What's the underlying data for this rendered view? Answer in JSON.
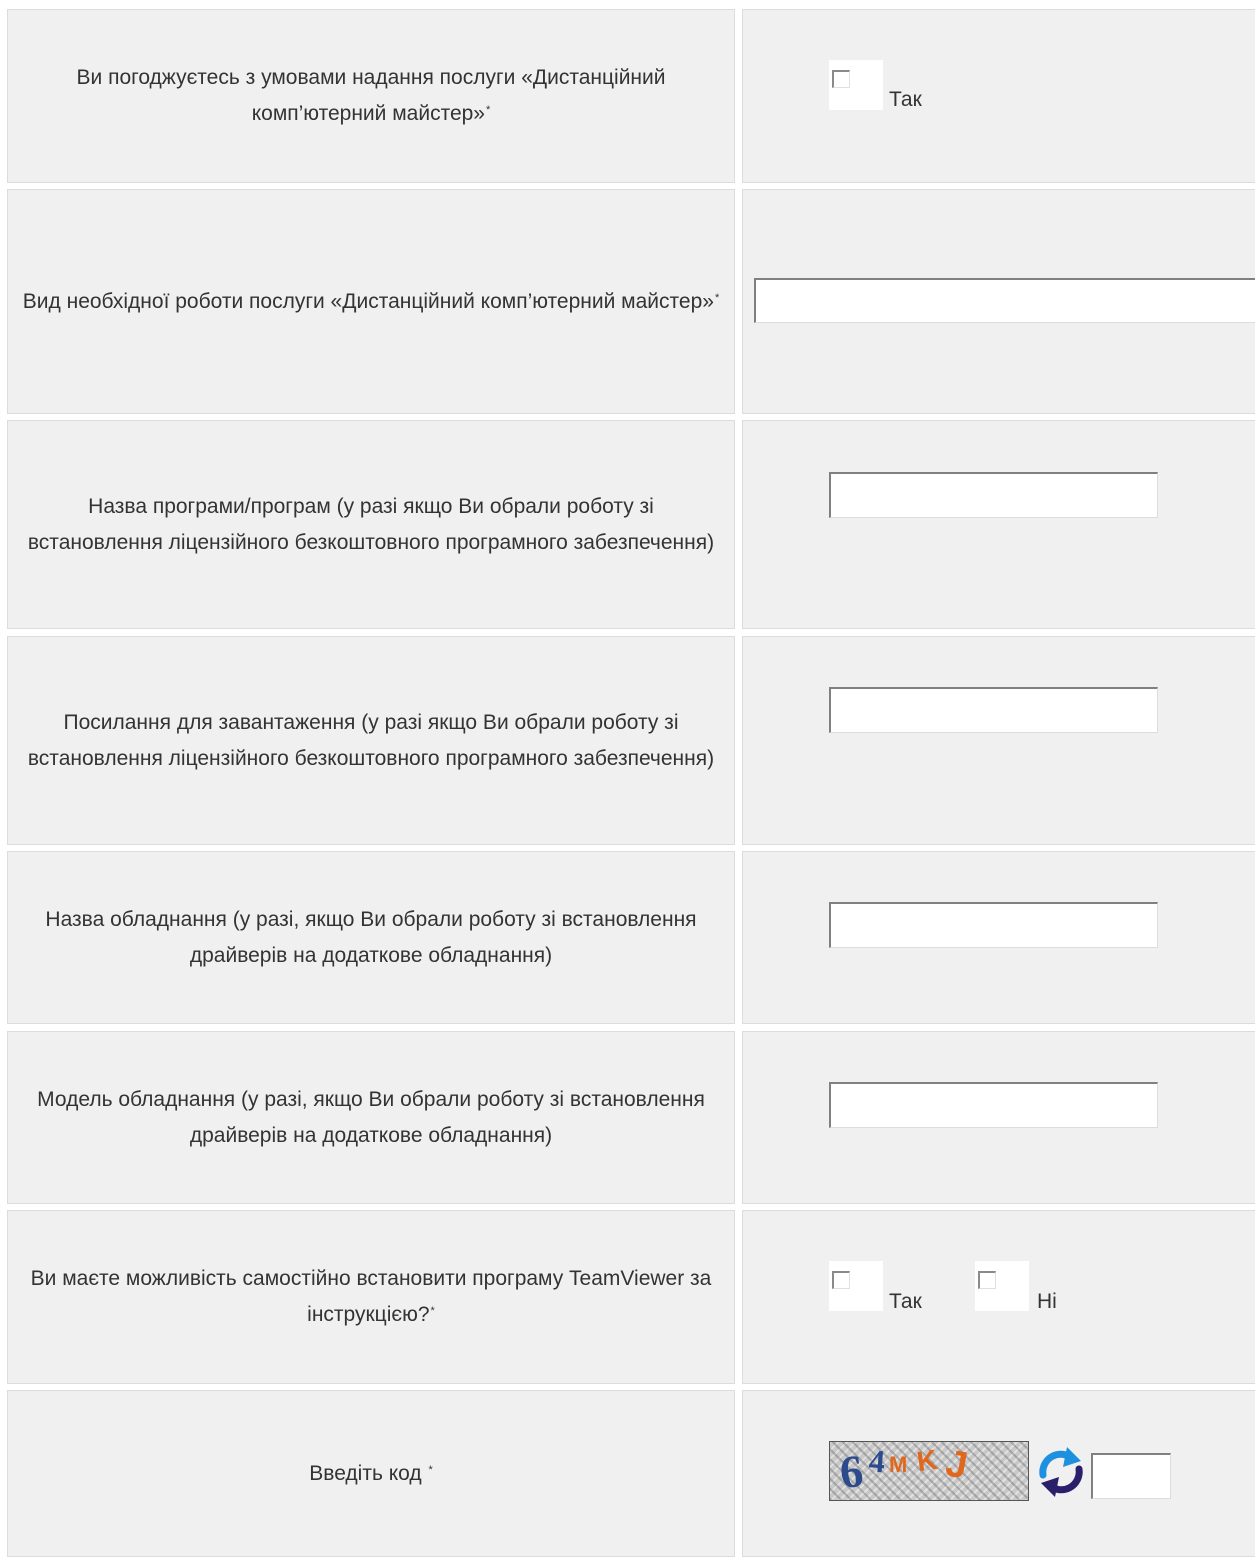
{
  "form": {
    "agree": {
      "question": "Ви погоджуєтесь з умовами надання послуги «Дистанційний комп’ютерний майстер»",
      "required_mark": "*",
      "option_yes": "Так"
    },
    "work_type": {
      "question": "Вид необхідної роботи послуги «Дистанційний комп’ютерний майстер»",
      "required_mark": "*",
      "value": ""
    },
    "program_name": {
      "question": "Назва програми/програм (у разі якщо Ви обрали роботу зі встановлення ліцензійного безкоштовного програмного забезпечення)",
      "value": ""
    },
    "download_link": {
      "question": "Посилання для завантаження (у разі якщо Ви обрали роботу зі встановлення ліцензійного безкоштовного програмного забезпечення)",
      "value": ""
    },
    "equipment_name": {
      "question": "Назва обладнання (у разі, якщо Ви обрали роботу зі встановлення драйверів на додаткове обладнання)",
      "value": ""
    },
    "equipment_model": {
      "question": "Модель обладнання (у разі, якщо Ви обрали роботу зі встановлення драйверів на додаткове обладнання)",
      "value": ""
    },
    "teamviewer": {
      "question": "Ви маєте можливість самостійно встановити програму TeamViewer за інструкцією?",
      "required_mark": "*",
      "option_yes": "Так",
      "option_no": "Ні"
    },
    "captcha": {
      "label": "Введіть код ",
      "required_mark": "*",
      "image_chars": [
        "6",
        "4",
        "M",
        "K",
        "J"
      ],
      "image_colors": [
        "#2d4a8c",
        "#2d4a8c",
        "#e0681e",
        "#e0681e",
        "#e0681e"
      ],
      "value": ""
    }
  },
  "colors": {
    "cell_bg": "#f0f0f0",
    "refresh_blue": "#1e90e0",
    "refresh_navy": "#2a1f6b"
  }
}
